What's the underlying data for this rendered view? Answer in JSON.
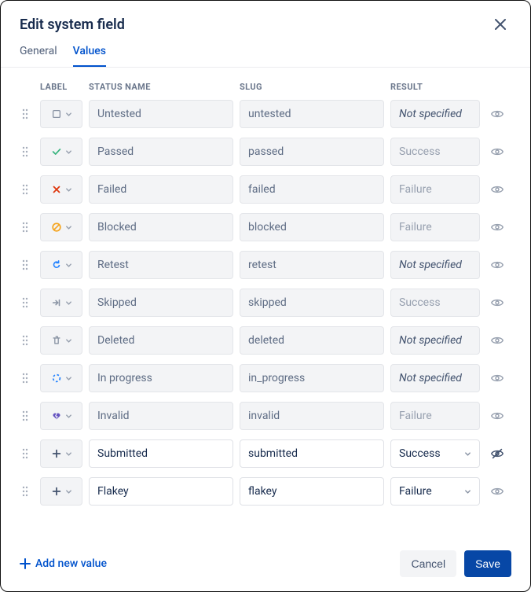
{
  "title": "Edit system field",
  "tabs": {
    "general": "General",
    "values": "Values",
    "active": "values"
  },
  "columns": {
    "label": "LABEL",
    "status_name": "STATUS NAME",
    "slug": "SLUG",
    "result": "RESULT"
  },
  "rows": [
    {
      "icon": "square",
      "status_name": "Untested",
      "slug": "untested",
      "result": "Not specified",
      "result_kind": "ns",
      "editable": false,
      "visible": true
    },
    {
      "icon": "check",
      "status_name": "Passed",
      "slug": "passed",
      "result": "Success",
      "result_kind": "lock",
      "editable": false,
      "visible": true
    },
    {
      "icon": "cross",
      "status_name": "Failed",
      "slug": "failed",
      "result": "Failure",
      "result_kind": "lock",
      "editable": false,
      "visible": true
    },
    {
      "icon": "forbid",
      "status_name": "Blocked",
      "slug": "blocked",
      "result": "Failure",
      "result_kind": "lock",
      "editable": false,
      "visible": true
    },
    {
      "icon": "retry",
      "status_name": "Retest",
      "slug": "retest",
      "result": "Not specified",
      "result_kind": "ns",
      "editable": false,
      "visible": true
    },
    {
      "icon": "skip",
      "status_name": "Skipped",
      "slug": "skipped",
      "result": "Success",
      "result_kind": "lock",
      "editable": false,
      "visible": true
    },
    {
      "icon": "trash",
      "status_name": "Deleted",
      "slug": "deleted",
      "result": "Not specified",
      "result_kind": "ns",
      "editable": false,
      "visible": true
    },
    {
      "icon": "progress",
      "status_name": "In progress",
      "slug": "in_progress",
      "result": "Not specified",
      "result_kind": "ns",
      "editable": false,
      "visible": true
    },
    {
      "icon": "heartbreak",
      "status_name": "Invalid",
      "slug": "invalid",
      "result": "Failure",
      "result_kind": "lock",
      "editable": false,
      "visible": true
    },
    {
      "icon": "plus",
      "status_name": "Submitted",
      "slug": "submitted",
      "result": "Success",
      "result_kind": "select",
      "editable": true,
      "visible": false
    },
    {
      "icon": "plus",
      "status_name": "Flakey",
      "slug": "flakey",
      "result": "Failure",
      "result_kind": "select",
      "editable": true,
      "visible": true
    }
  ],
  "footer": {
    "add_new": "Add new value",
    "cancel": "Cancel",
    "save": "Save"
  }
}
